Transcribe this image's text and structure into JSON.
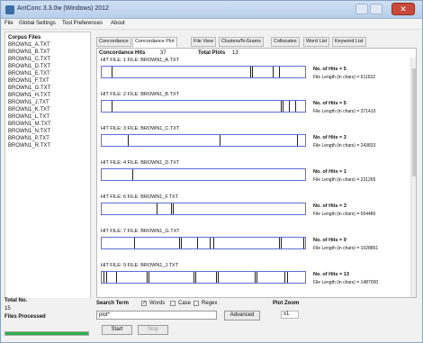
{
  "window": {
    "title": "AntConc 3.3.0w (Windows) 2012"
  },
  "menu": {
    "items": [
      "File",
      "Global Settings",
      "Tool Preferences",
      "About"
    ]
  },
  "sidebar": {
    "heading": "Corpus Files",
    "files": [
      "BROWN1_A.TXT",
      "BROWN1_B.TXT",
      "BROWN1_C.TXT",
      "BROWN1_D.TXT",
      "BROWN1_E.TXT",
      "BROWN1_F.TXT",
      "BROWN1_G.TXT",
      "BROWN1_H.TXT",
      "BROWN1_J.TXT",
      "BROWN1_K.TXT",
      "BROWN1_L.TXT",
      "BROWN1_M.TXT",
      "BROWN1_N.TXT",
      "BROWN1_P.TXT",
      "BROWN1_R.TXT"
    ],
    "total_label": "Total No.",
    "total_value": "15",
    "processed_label": "Files Processed",
    "progress": 1.0
  },
  "tabs": [
    "Concordance",
    "Concordance Plot",
    "File View",
    "Clusters/N-Grams",
    "Collocates",
    "Word List",
    "Keyword List"
  ],
  "active_tab": 1,
  "header": {
    "hits_label": "Concordance Hits",
    "hits_value": "37",
    "plots_label": "Total Plots",
    "plots_value": "13"
  },
  "plots": [
    {
      "caption": "HIT FILE: 1   FILE: BROWN1_A.TXT",
      "hits": "No. of Hits = 5",
      "length": "File Length (in chars) = 611632",
      "positions": [
        0.05,
        0.73,
        0.74,
        0.84,
        0.87
      ]
    },
    {
      "caption": "HIT FILE: 2   FILE: BROWN1_B.TXT",
      "hits": "No. of Hits = 5",
      "length": "File Length (in chars) = 371410",
      "positions": [
        0.05,
        0.88,
        0.89,
        0.92,
        0.95
      ]
    },
    {
      "caption": "HIT FILE: 3   FILE: BROWN1_C.TXT",
      "hits": "No. of Hits = 3",
      "length": "File Length (in chars) = 243833",
      "positions": [
        0.13,
        0.58,
        0.96
      ]
    },
    {
      "caption": "HIT FILE: 4   FILE: BROWN1_D.TXT",
      "hits": "No. of Hits = 1",
      "length": "File Length (in chars) = 231265",
      "positions": [
        0.15
      ]
    },
    {
      "caption": "HIT FILE: 6   FILE: BROWN1_F.TXT",
      "hits": "No. of Hits = 3",
      "length": "File Length (in chars) = 654486",
      "positions": [
        0.27,
        0.34,
        0.35
      ]
    },
    {
      "caption": "HIT FILE: 7   FILE: BROWN1_G.TXT",
      "hits": "No. of Hits = 9",
      "length": "File Length (in chars) = 1028861",
      "positions": [
        0.16,
        0.38,
        0.39,
        0.47,
        0.53,
        0.55,
        0.87,
        0.88,
        0.99
      ]
    },
    {
      "caption": "HIT FILE: 9   FILE: BROWN1_J.TXT",
      "hits": "No. of Hits = 13",
      "length": "File Length (in chars) = 1487000",
      "positions": [
        0.01,
        0.02,
        0.07,
        0.22,
        0.23,
        0.45,
        0.46,
        0.56,
        0.57,
        0.75,
        0.76,
        0.9,
        0.91
      ]
    }
  ],
  "controls": {
    "search_label": "Search Term",
    "words_label": "Words",
    "case_label": "Case",
    "regex_label": "Regex",
    "search_value": "plot*",
    "advanced_label": "Advanced",
    "zoom_label": "Plot Zoom",
    "zoom_value": "x1",
    "start_label": "Start",
    "stop_label": "Stop"
  }
}
